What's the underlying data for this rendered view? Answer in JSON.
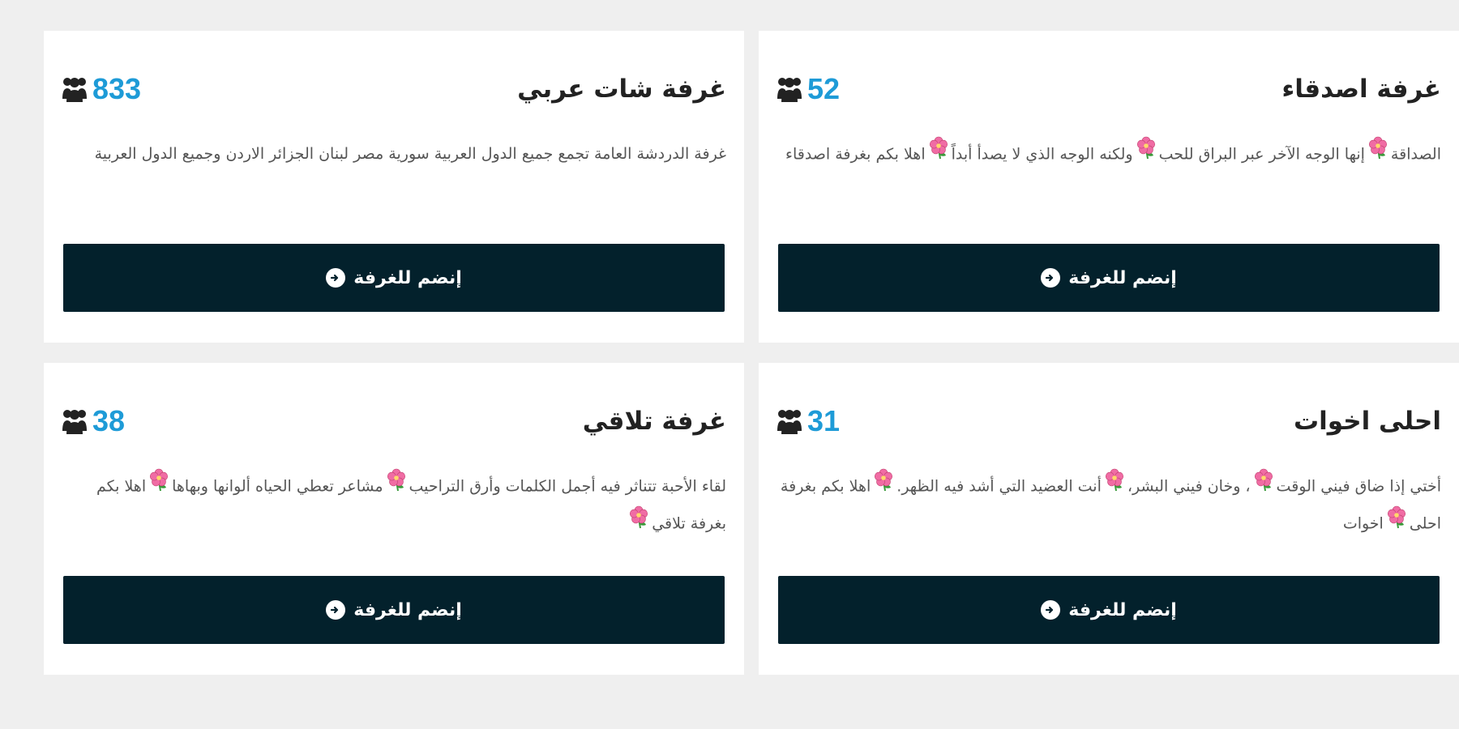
{
  "colors": {
    "page_bg": "#efefef",
    "card_bg": "#ffffff",
    "count": "#1e9bd7",
    "button_bg": "#03212c",
    "title": "#222222",
    "description": "#555555"
  },
  "icons": {
    "members": "users-icon",
    "join": "enter-circle-icon",
    "emoji": "pink-flower-icon"
  },
  "rooms": [
    {
      "name": "غرفة اصدقاء",
      "count": "52",
      "description_parts": [
        "الصداقة",
        "إنها الوجه الآخر عبر البراق للحب",
        "ولكنه الوجه الذي لا يصدأ أبداً",
        "اهلا بكم بغرفة اصدقاء"
      ],
      "join_label": "إنضم للغرفة"
    },
    {
      "name": "غرفة شات عربي",
      "count": "833",
      "description_parts": [
        "غرفة الدردشة العامة تجمع جميع الدول العربية سورية مصر لبنان الجزائر الاردن وجميع الدول العربية"
      ],
      "join_label": "إنضم للغرفة"
    },
    {
      "name": "احلى اخوات",
      "count": "31",
      "description_parts": [
        "أختي إذا ضاق فيني الوقت",
        "، وخان فيني البشر،",
        "أنت العضيد التي أشد فيه الظهر.",
        "اهلا بكم بغرفة احلى",
        "اخوات"
      ],
      "join_label": "إنضم للغرفة"
    },
    {
      "name": "غرفة تلاقي",
      "count": "38",
      "description_parts": [
        "لقاء الأحبة تتناثر فيه أجمل الكلمات وأرق التراحيب",
        "مشاعر تعطي الحياه ألوانها وبهاها",
        "اهلا بكم بغرفة تلاقي",
        ""
      ],
      "join_label": "إنضم للغرفة"
    }
  ]
}
